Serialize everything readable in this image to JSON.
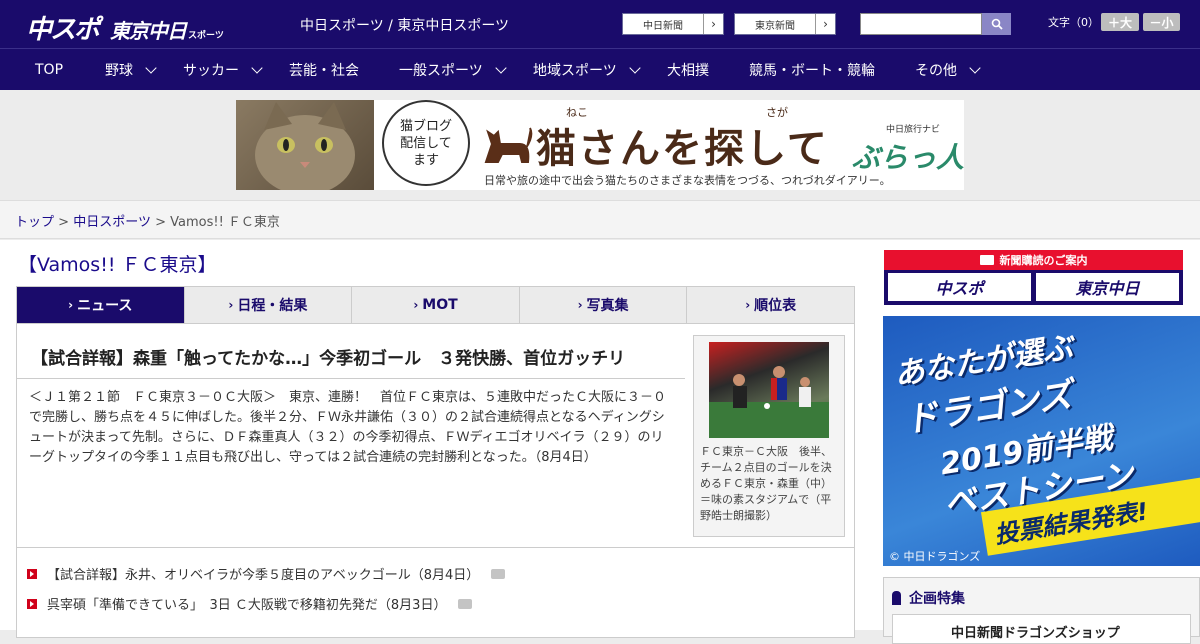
{
  "header": {
    "logo_main": "中スポ",
    "logo_second": "東京中日",
    "logo_second_sub": "スポーツ",
    "site_name": "中日スポーツ / 東京中日スポーツ",
    "link1": "中日新聞",
    "link2": "東京新聞",
    "font_label": "文字（0）",
    "font_large": "＋大",
    "font_small": "－小"
  },
  "nav": {
    "items": [
      "TOP",
      "野球",
      "サッカー",
      "芸能・社会",
      "一般スポーツ",
      "地域スポーツ",
      "大相撲",
      "競馬・ボート・競輪",
      "その他"
    ]
  },
  "ad": {
    "bubble_text": "猫ブログ\n配信して\nます",
    "title": "猫さんを探して",
    "ruby1": "ねこ",
    "ruby2": "さが",
    "subtitle": "日常や旅の途中で出会う猫たちのさまざまな表情をつづる、つれづれダイアリー。",
    "brand": "ぶらっ人",
    "brand_small": "中日旅行ナビ"
  },
  "breadcrumb": {
    "home": "トップ",
    "section": "中日スポーツ",
    "current": "Vamos!! ＦＣ東京",
    "sep": ">"
  },
  "page_title": "【Vamos!! ＦＣ東京】",
  "tabs": [
    "ニュース",
    "日程・結果",
    "MOT",
    "写真集",
    "順位表"
  ],
  "article": {
    "headline": "【試合詳報】森重「触ってたかな…」今季初ゴール　３発快勝、首位ガッチリ",
    "body": "＜Ｊ１第２１節　ＦＣ東京３－０Ｃ大阪＞　東京、連勝！　首位ＦＣ東京は、５連敗中だったＣ大阪に３－０で完勝し、勝ち点を４５に伸ばした。後半２分、ＦＷ永井謙佑（３０）の２試合連続得点となるヘディングシュートが決まって先制。さらに、ＤＦ森重真人（３２）の今季初得点、ＦＷディエゴオリベイラ（２９）のリーグトップタイの今季１１点目も飛び出し、守っては２試合連続の完封勝利となった。（8月4日）",
    "caption": "ＦＣ東京－Ｃ大阪　後半、チーム２点目のゴールを決めるＦＣ東京・森重（中）＝味の素スタジアムで（平野皓士朗撮影）"
  },
  "related": [
    "【試合詳報】永井、オリベイラが今季５度目のアベックゴール（8月4日）",
    "呉宰碩「準備できている」　3日 Ｃ大阪戦で移籍初先発だ（8月3日）"
  ],
  "sidebar": {
    "subscribe_head": "新聞購読のご案内",
    "sub_btn1": "中スポ",
    "sub_btn2": "東京中日",
    "ad_line1": "あなたが選ぶ",
    "ad_line2": "ドラゴンズ",
    "ad_line3": "2019前半戦",
    "ad_line4": "ベストシーン",
    "ad_banner": "投票結果発表!",
    "ad_copyright": "© 中日ドラゴンズ",
    "feature_title": "企画特集",
    "feature_item": "中日新聞ドラゴンズショップ"
  },
  "colors": {
    "brand": "#1a0b6b",
    "accent": "#e8102e",
    "link": "#1a0b8b"
  }
}
